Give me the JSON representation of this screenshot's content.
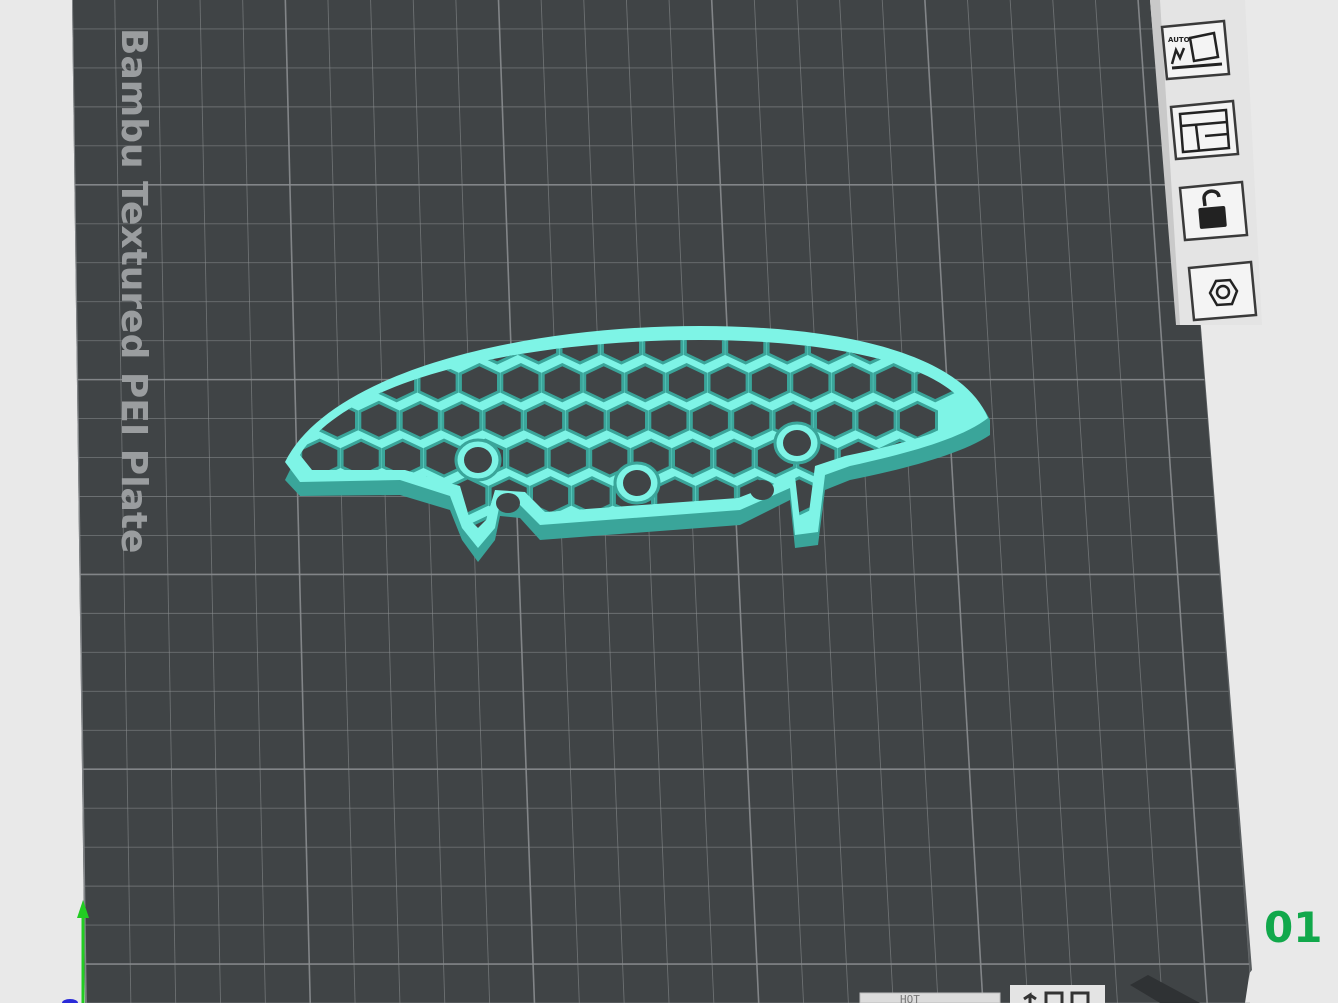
{
  "viewport": {
    "background_color": "#e9e9e9",
    "bed_color": "#404446",
    "bed_edge_color": "#5a5e60",
    "grid_color": "#8a8d8f",
    "model_color": "#7ef4e6",
    "model_shadow_color": "#3aa59a"
  },
  "plate": {
    "label": "Bambu Textured PEI Plate",
    "number": "01",
    "number_color": "#11a84b"
  },
  "plate_toolbar": {
    "auto_label": "AUTO",
    "buttons": [
      {
        "name": "auto-orient-button",
        "icon": "auto-orient-icon"
      },
      {
        "name": "arrange-button",
        "icon": "arrange-icon"
      },
      {
        "name": "lock-plate-button",
        "icon": "unlock-icon"
      },
      {
        "name": "plate-settings-button",
        "icon": "hex-nut-icon"
      }
    ]
  },
  "bottom_bar": {
    "text": "HOT"
  },
  "axes": {
    "z_color": "#22cc22",
    "x_color": "#2a2ad8"
  }
}
